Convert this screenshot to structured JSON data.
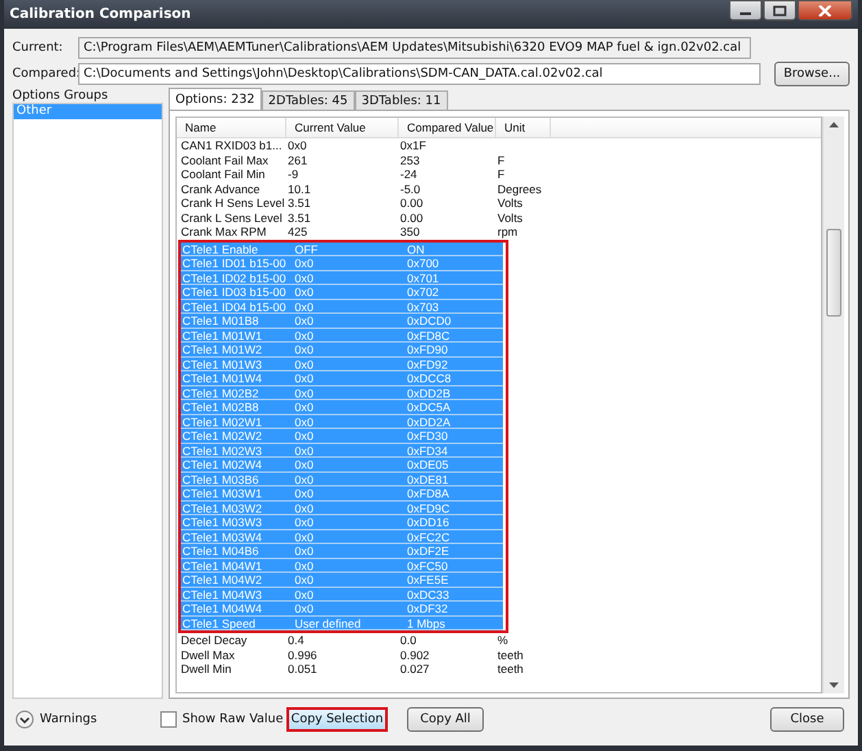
{
  "window": {
    "title": "Calibration Comparison"
  },
  "current": {
    "label": "Current:",
    "value": "C:\\Program Files\\AEM\\AEMTuner\\Calibrations\\AEM Updates\\Mitsubishi\\6320 EVO9 MAP fuel & ign.02v02.cal"
  },
  "compared": {
    "label": "Compared:",
    "value": "C:\\Documents and Settings\\John\\Desktop\\Calibrations\\SDM-CAN_DATA.cal.02v02.cal"
  },
  "browse_button": "Browse...",
  "sidebar": {
    "title": "Options Groups",
    "items": [
      {
        "label": "Other",
        "selected": true
      }
    ]
  },
  "tabs": [
    {
      "label": "Options: 232",
      "selected": true
    },
    {
      "label": "2DTables: 45",
      "selected": false
    },
    {
      "label": "3DTables: 11",
      "selected": false
    }
  ],
  "table": {
    "columns": [
      "Name",
      "Current Value",
      "Compared Value",
      "Unit"
    ],
    "rows": [
      {
        "cells": [
          "CAN1 RXID03 b1...",
          "0x0",
          "0x1F",
          ""
        ],
        "selected": false
      },
      {
        "cells": [
          "Coolant Fail Max",
          "261",
          "253",
          "F"
        ],
        "selected": false
      },
      {
        "cells": [
          "Coolant Fail Min",
          "-9",
          "-24",
          "F"
        ],
        "selected": false
      },
      {
        "cells": [
          "Crank Advance",
          "10.1",
          "-5.0",
          "Degrees"
        ],
        "selected": false
      },
      {
        "cells": [
          "Crank H Sens Level",
          "3.51",
          "0.00",
          "Volts"
        ],
        "selected": false
      },
      {
        "cells": [
          "Crank L Sens Level",
          "3.51",
          "0.00",
          "Volts"
        ],
        "selected": false
      },
      {
        "cells": [
          "Crank Max RPM",
          "425",
          "350",
          "rpm"
        ],
        "selected": false
      },
      {
        "cells": [
          "CTele1 Enable",
          "OFF",
          "ON",
          ""
        ],
        "selected": true
      },
      {
        "cells": [
          "CTele1 ID01 b15-00",
          "0x0",
          "0x700",
          ""
        ],
        "selected": true
      },
      {
        "cells": [
          "CTele1 ID02 b15-00",
          "0x0",
          "0x701",
          ""
        ],
        "selected": true
      },
      {
        "cells": [
          "CTele1 ID03 b15-00",
          "0x0",
          "0x702",
          ""
        ],
        "selected": true
      },
      {
        "cells": [
          "CTele1 ID04 b15-00",
          "0x0",
          "0x703",
          ""
        ],
        "selected": true
      },
      {
        "cells": [
          "CTele1 M01B8",
          "0x0",
          "0xDCD0",
          ""
        ],
        "selected": true
      },
      {
        "cells": [
          "CTele1 M01W1",
          "0x0",
          "0xFD8C",
          ""
        ],
        "selected": true
      },
      {
        "cells": [
          "CTele1 M01W2",
          "0x0",
          "0xFD90",
          ""
        ],
        "selected": true
      },
      {
        "cells": [
          "CTele1 M01W3",
          "0x0",
          "0xFD92",
          ""
        ],
        "selected": true
      },
      {
        "cells": [
          "CTele1 M01W4",
          "0x0",
          "0xDCC8",
          ""
        ],
        "selected": true
      },
      {
        "cells": [
          "CTele1 M02B2",
          "0x0",
          "0xDD2B",
          ""
        ],
        "selected": true
      },
      {
        "cells": [
          "CTele1 M02B8",
          "0x0",
          "0xDC5A",
          ""
        ],
        "selected": true
      },
      {
        "cells": [
          "CTele1 M02W1",
          "0x0",
          "0xDD2A",
          ""
        ],
        "selected": true
      },
      {
        "cells": [
          "CTele1 M02W2",
          "0x0",
          "0xFD30",
          ""
        ],
        "selected": true
      },
      {
        "cells": [
          "CTele1 M02W3",
          "0x0",
          "0xFD34",
          ""
        ],
        "selected": true
      },
      {
        "cells": [
          "CTele1 M02W4",
          "0x0",
          "0xDE05",
          ""
        ],
        "selected": true
      },
      {
        "cells": [
          "CTele1 M03B6",
          "0x0",
          "0xDE81",
          ""
        ],
        "selected": true
      },
      {
        "cells": [
          "CTele1 M03W1",
          "0x0",
          "0xFD8A",
          ""
        ],
        "selected": true
      },
      {
        "cells": [
          "CTele1 M03W2",
          "0x0",
          "0xFD9C",
          ""
        ],
        "selected": true
      },
      {
        "cells": [
          "CTele1 M03W3",
          "0x0",
          "0xDD16",
          ""
        ],
        "selected": true
      },
      {
        "cells": [
          "CTele1 M03W4",
          "0x0",
          "0xFC2C",
          ""
        ],
        "selected": true
      },
      {
        "cells": [
          "CTele1 M04B6",
          "0x0",
          "0xDF2E",
          ""
        ],
        "selected": true
      },
      {
        "cells": [
          "CTele1 M04W1",
          "0x0",
          "0xFC50",
          ""
        ],
        "selected": true
      },
      {
        "cells": [
          "CTele1 M04W2",
          "0x0",
          "0xFE5E",
          ""
        ],
        "selected": true
      },
      {
        "cells": [
          "CTele1 M04W3",
          "0x0",
          "0xDC33",
          ""
        ],
        "selected": true
      },
      {
        "cells": [
          "CTele1 M04W4",
          "0x0",
          "0xDF32",
          ""
        ],
        "selected": true
      },
      {
        "cells": [
          "CTele1 Speed",
          "User defined",
          "1 Mbps",
          ""
        ],
        "selected": true
      },
      {
        "cells": [
          "Decel Decay",
          "0.4",
          "0.0",
          "%"
        ],
        "selected": false
      },
      {
        "cells": [
          "Dwell Max",
          "0.996",
          "0.902",
          "teeth"
        ],
        "selected": false
      },
      {
        "cells": [
          "Dwell Min",
          "0.051",
          "0.027",
          "teeth"
        ],
        "selected": false
      }
    ]
  },
  "footer": {
    "warnings": "Warnings",
    "show_raw": {
      "label": "Show Raw Value",
      "checked": false
    },
    "buttons": [
      {
        "label": "Copy Selection",
        "highlighted": true
      },
      {
        "label": "Copy All",
        "highlighted": false
      },
      {
        "label": "Close",
        "highlighted": false
      }
    ]
  }
}
